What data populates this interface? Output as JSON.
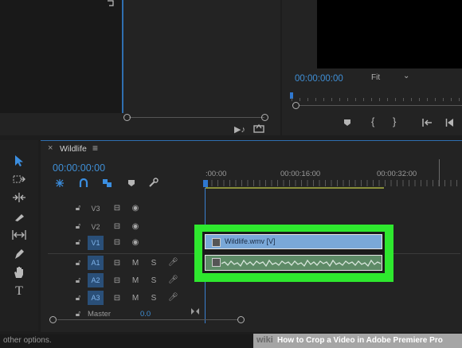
{
  "source_monitor": {
    "scroll_handle": "○"
  },
  "program_monitor": {
    "timecode": "00:00:00:00",
    "fit_label": "Fit",
    "fit_chevron": "⌄",
    "buttons": [
      "marker-icon",
      "mark-in-icon",
      "mark-out-icon",
      "go-to-in-icon",
      "step-back-icon"
    ]
  },
  "timeline": {
    "tab_title": "Wildlife",
    "close_glyph": "×",
    "menu_glyph": "≡",
    "timecode": "00:00:00:00",
    "ruler": [
      ":00:00",
      "00:00:16:00",
      "00:00:32:00"
    ],
    "tracks": [
      {
        "name": "V3",
        "type": "video",
        "selected": false
      },
      {
        "name": "V2",
        "type": "video",
        "selected": false
      },
      {
        "name": "V1",
        "type": "video",
        "selected": true
      },
      {
        "name": "A1",
        "type": "audio",
        "selected": true
      },
      {
        "name": "A2",
        "type": "audio",
        "selected": true
      },
      {
        "name": "A3",
        "type": "audio",
        "selected": true
      }
    ],
    "master_label": "Master",
    "master_value": "0.0",
    "mute_label": "M",
    "solo_label": "S",
    "clip_video_label": "Wildlife.wmv [V]",
    "highlight_color": "#2ee82e"
  },
  "tools": [
    "selection-tool",
    "track-select-tool",
    "ripple-edit-tool",
    "razor-tool",
    "slip-tool",
    "pen-tool",
    "hand-tool",
    "type-tool"
  ],
  "status_bar": {
    "text": "other options."
  },
  "watermark": {
    "wiki": "wiki",
    "rest": "How to Crop a Video in Adobe Premiere Pro"
  }
}
